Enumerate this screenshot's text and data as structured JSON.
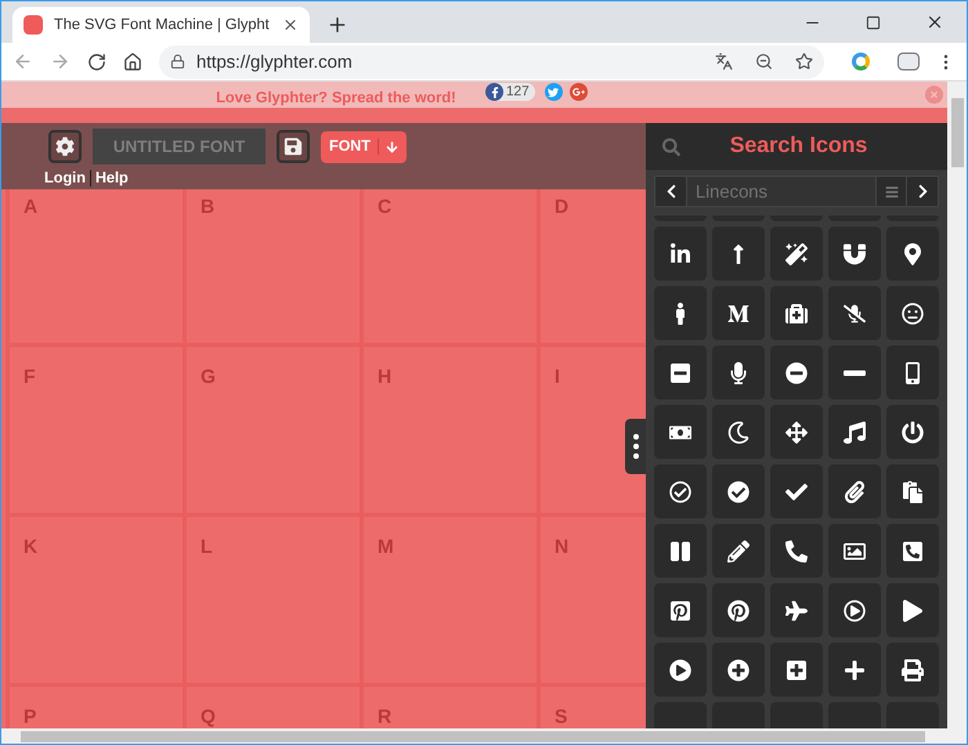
{
  "browser": {
    "tab_title": "The SVG Font Machine | Glypht",
    "url": "https://glyphter.com"
  },
  "banner": {
    "text": "Love Glyphter? Spread the word!",
    "share_count": "127"
  },
  "toolbar": {
    "font_name_placeholder": "UNTITLED FONT",
    "download_label": "FONT",
    "links": [
      "Login",
      "Help"
    ]
  },
  "canvas": {
    "cells": [
      "A",
      "B",
      "C",
      "D",
      "F",
      "G",
      "H",
      "I",
      "K",
      "L",
      "M",
      "N",
      "P",
      "Q",
      "R",
      "S"
    ]
  },
  "panel": {
    "title": "Search Icons",
    "icon_set_placeholder": "Linecons"
  }
}
